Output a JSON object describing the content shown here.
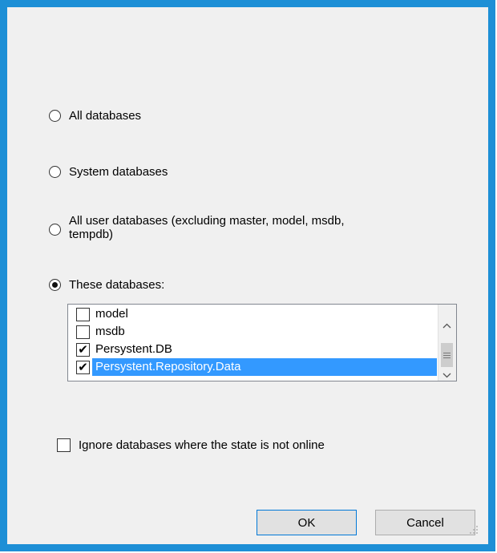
{
  "options": {
    "all_databases": "All databases",
    "system_databases": "System databases",
    "all_user_databases_line1": "All user databases  (excluding master, model, msdb,",
    "all_user_databases_line2": "tempdb)",
    "these_databases": "These databases:",
    "selected": "these_databases"
  },
  "database_list": {
    "items": [
      {
        "label": "model",
        "checked": false,
        "selected": false
      },
      {
        "label": "msdb",
        "checked": false,
        "selected": false
      },
      {
        "label": "Persystent.DB",
        "checked": true,
        "selected": false
      },
      {
        "label": "Persystent.Repository.Data",
        "checked": true,
        "selected": true
      }
    ],
    "selection_color": "#3399ff"
  },
  "ignore_offline": {
    "label": "Ignore databases where the state is not online",
    "checked": false
  },
  "buttons": {
    "ok": "OK",
    "cancel": "Cancel"
  },
  "colors": {
    "border_accent": "#1d8fd6",
    "dialog_bg": "#f0f0f0"
  },
  "icons": {
    "check": "✔",
    "scroll_up": "chevron-up-icon",
    "scroll_down": "chevron-down-icon"
  }
}
